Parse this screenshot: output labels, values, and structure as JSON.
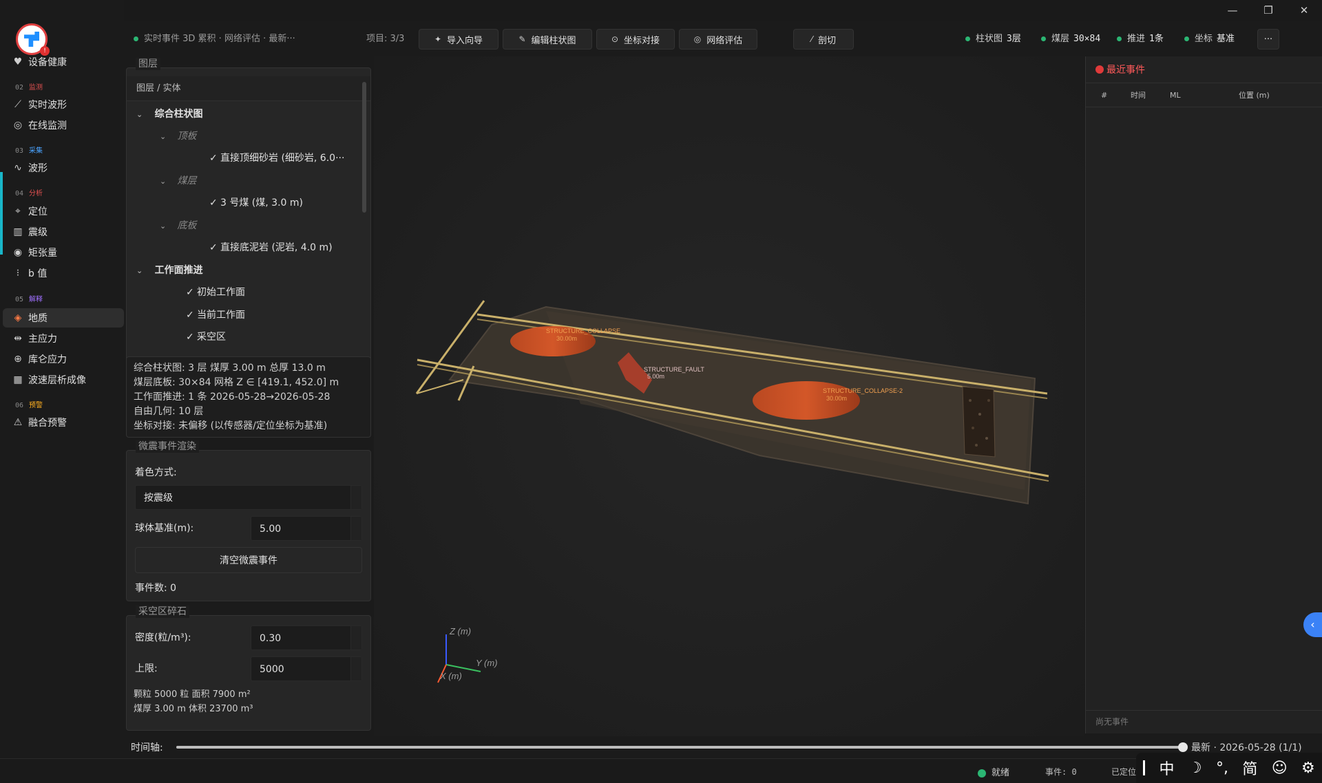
{
  "app": {
    "status_dot_color": "#2bb673"
  },
  "sidebar": {
    "logo_badge": "!",
    "top_item": "设备健康",
    "sections": [
      {
        "num": "02",
        "title": "监测",
        "color": "#e05050"
      },
      {
        "num": "03",
        "title": "采集",
        "color": "#4aa3ff"
      },
      {
        "num": "04",
        "title": "分析",
        "color": "#e05050"
      },
      {
        "num": "05",
        "title": "解释",
        "color": "#a070ff"
      },
      {
        "num": "06",
        "title": "预警",
        "color": "#ffb020"
      }
    ],
    "items": [
      "实时波形",
      "在线监测",
      "波形",
      "定位",
      "震级",
      "矩张量",
      "b 值",
      "地质",
      "主应力",
      "库仑应力",
      "波速层析成像",
      "融合预警"
    ]
  },
  "toolbar": {
    "breadcrumb": "实时事件 3D 累积 · 网络评估 · 最新···",
    "project": "项目: 3/3",
    "buttons": [
      "导入向导",
      "编辑柱状图",
      "坐标对接",
      "网络评估",
      "剖切"
    ],
    "stats": [
      {
        "label": "柱状图",
        "value": "3层"
      },
      {
        "label": "煤层",
        "value": "30×84"
      },
      {
        "label": "推进",
        "value": "1条"
      },
      {
        "label": "坐标",
        "value": "基准"
      }
    ],
    "more": "···"
  },
  "layers": {
    "title": "图层",
    "header": "图层 / 实体",
    "tree": [
      {
        "label": "综合柱状图",
        "level": 0,
        "type": "group"
      },
      {
        "label": "顶板",
        "level": 1,
        "type": "sub"
      },
      {
        "label": "直接顶细砂岩 (细砂岩, 6.0···",
        "level": 2,
        "type": "leaf"
      },
      {
        "label": "煤层",
        "level": 1,
        "type": "sub"
      },
      {
        "label": "3 号煤 (煤, 3.0 m)",
        "level": 2,
        "type": "leaf"
      },
      {
        "label": "底板",
        "level": 1,
        "type": "sub"
      },
      {
        "label": "直接底泥岩 (泥岩, 4.0 m)",
        "level": 2,
        "type": "leaf"
      },
      {
        "label": "工作面推进",
        "level": 0,
        "type": "group"
      },
      {
        "label": "初始工作面",
        "level": 1,
        "type": "leaf"
      },
      {
        "label": "当前工作面",
        "level": 1,
        "type": "leaf"
      },
      {
        "label": "采空区",
        "level": 1,
        "type": "leaf"
      }
    ]
  },
  "info": [
    "综合柱状图: 3 层  煤厚 3.00 m  总厚 13.0 m",
    "煤层底板: 30×84 网格  Z ∈ [419.1, 452.0] m",
    "工作面推进: 1 条  2026-05-28→2026-05-28",
    "自由几何: 10 层",
    "坐标对接: 未偏移 (以传感器/定位坐标为基准)"
  ],
  "render": {
    "title": "微震事件渲染",
    "color_mode_label": "着色方式:",
    "color_mode_value": "按震级",
    "sphere_label": "球体基准(m):",
    "sphere_value": "5.00",
    "clear_button": "清空微震事件",
    "count": "事件数: 0"
  },
  "gob": {
    "title": "采空区碎石",
    "density_label": "密度(粒/m³):",
    "density_value": "0.30",
    "limit_label": "上限:",
    "limit_value": "5000",
    "stat1": "颗粒 5000 粒  面积 7900 m²",
    "stat2": "煤厚 3.00 m  体积 23700 m³"
  },
  "scene": {
    "labels": [
      {
        "name": "STRUCTURE_COLLAPSE",
        "size": "30.00m"
      },
      {
        "name": "STRUCTURE_FAULT",
        "size": "5.00m"
      },
      {
        "name": "STRUCTURE_COLLAPSE-2",
        "size": "30.00m"
      }
    ],
    "axes": {
      "z": "Z (m)",
      "y": "Y (m)",
      "x": "X (m)"
    }
  },
  "events": {
    "title": "最近事件",
    "columns": [
      "#",
      "时间",
      "ML",
      "位置 (m)"
    ],
    "empty": "尚无事件"
  },
  "timeline": {
    "label": "时间轴:",
    "value": "最新 · 2026-05-28 (1/1)",
    "progress": 1.0
  },
  "status": {
    "ready": "就绪",
    "events": "事件: 0",
    "located": "已定位"
  },
  "ime": [
    "中",
    "☽",
    "°,",
    "简",
    "☺",
    "⚙"
  ]
}
